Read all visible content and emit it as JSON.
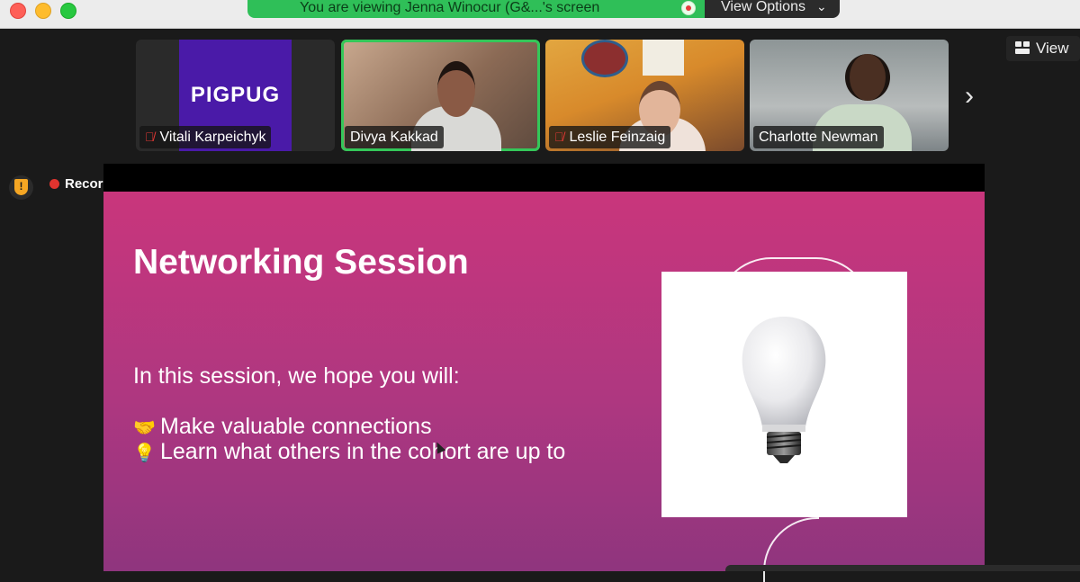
{
  "window": {
    "share_banner": "You are viewing Jenna Winocur (G&...'s screen",
    "view_options": "View Options",
    "view_button": "View"
  },
  "participants": [
    {
      "name": "Vitali Karpeichyk",
      "muted": true,
      "logo_text": "PIGPUG"
    },
    {
      "name": "Divya Kakkad",
      "muted": false,
      "active_speaker": true
    },
    {
      "name": "Leslie Feinzaig",
      "muted": true
    },
    {
      "name": "Charlotte Newman",
      "muted": false
    }
  ],
  "status": {
    "recording_label": "Recording"
  },
  "slide": {
    "title": "Networking Session",
    "intro": "In this session, we hope you will:",
    "bullets": [
      {
        "emoji": "🤝",
        "text": "Make valuable connections"
      },
      {
        "emoji": "💡",
        "text": "Learn what others in the cohort are up to"
      }
    ]
  },
  "colors": {
    "banner_green": "#2fbf58",
    "active_border": "#34c759",
    "slide_magenta": "#c9367c",
    "recording_red": "#e0342f"
  }
}
